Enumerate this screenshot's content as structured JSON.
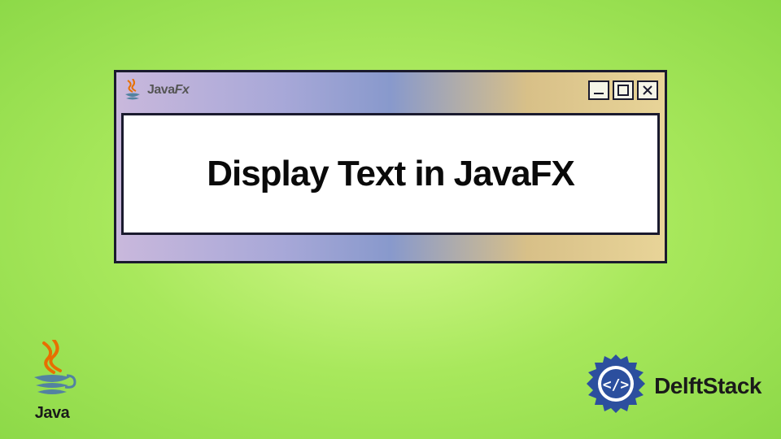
{
  "window": {
    "app_label_prefix": "Java",
    "app_label_suffix": "Fx",
    "content_text": "Display Text in JavaFX"
  },
  "logos": {
    "java_text": "Java",
    "delft_text": "DelftStack"
  },
  "colors": {
    "border": "#1a1a2e",
    "java_orange": "#e76f00",
    "java_blue": "#5382a1",
    "delft_blue": "#2c4f9e"
  }
}
